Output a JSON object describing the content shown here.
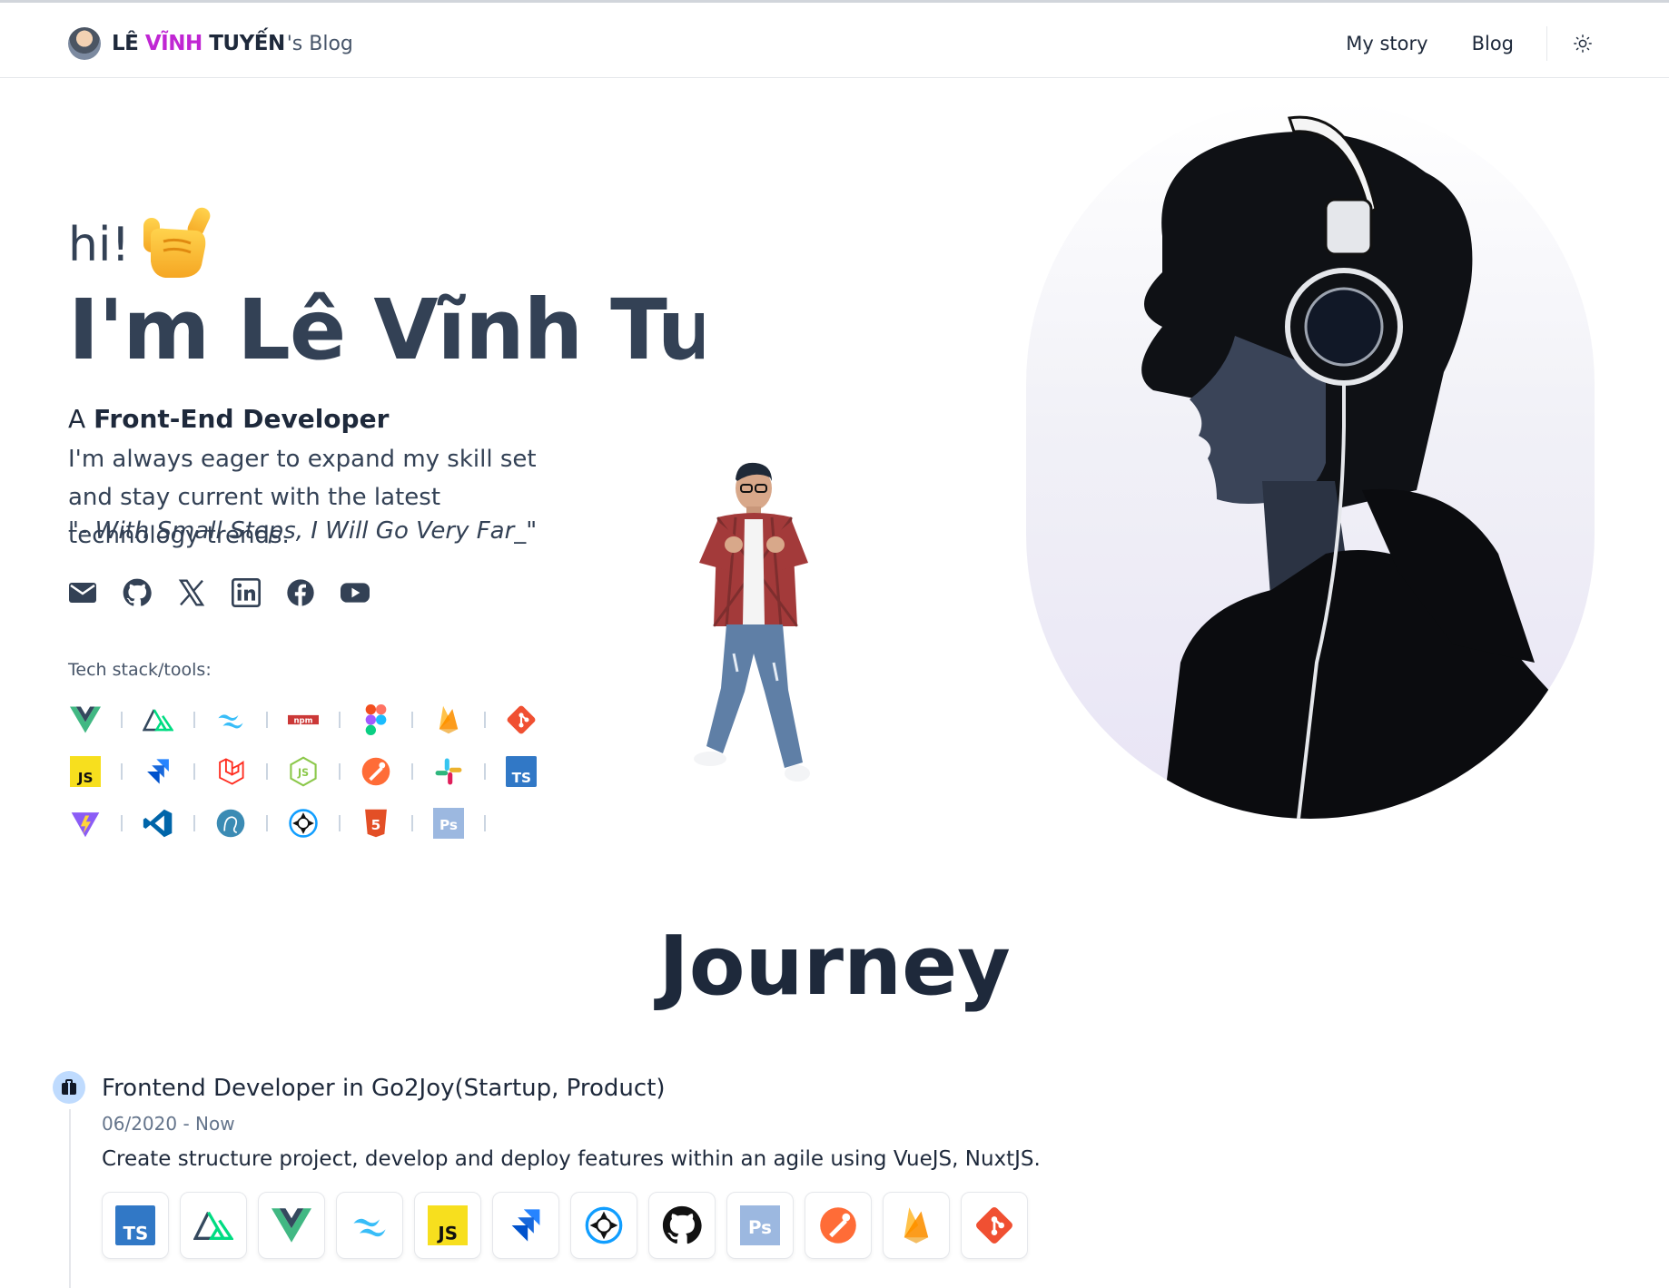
{
  "header": {
    "brand_name_part1": "LÊ ",
    "brand_name_highlight": "VĨNH",
    "brand_name_part2": " TUYẾN",
    "brand_suffix": "'s Blog",
    "nav": [
      {
        "label": "My story"
      },
      {
        "label": "Blog"
      }
    ],
    "theme_toggle_icon": "sun-icon"
  },
  "hero": {
    "greeting": "hi!",
    "greeting_emoji": "call-me-hand-icon",
    "name": "I'm Lê Vĩnh Tuy",
    "role_prefix": "A ",
    "role": "Front-End Developer",
    "bio": "I'm always eager to expand my skill set and stay current with the latest technology trends.",
    "quote": "\"- With Small Steps, I Will Go Very Far_\"",
    "socials": [
      "mail-icon",
      "github-icon",
      "x-icon",
      "linkedin-icon",
      "facebook-icon",
      "youtube-icon"
    ],
    "tech_label": "Tech stack/tools:",
    "tech_rows": [
      [
        "vue",
        "nuxt",
        "tailwind",
        "npm",
        "figma",
        "firebase",
        "git"
      ],
      [
        "javascript",
        "jira",
        "laravel",
        "nodejs",
        "postman",
        "slack",
        "typescript"
      ],
      [
        "vite",
        "vscode",
        "mysql",
        "capacitor",
        "html5",
        "photoshop"
      ]
    ],
    "tech_text": {
      "npm": "npm",
      "javascript": "JS",
      "typescript": "TS",
      "photoshop": "Ps",
      "nodejs": "JS",
      "html5": "5"
    }
  },
  "journey": {
    "title": "Journey",
    "jobs": [
      {
        "title": "Frontend Developer in Go2Joy(Startup, Product)",
        "date": "06/2020 - Now",
        "description": "Create structure project, develop and deploy features within an agile using VueJS, NuxtJS.",
        "tools": [
          "typescript",
          "nuxt",
          "vue",
          "tailwind",
          "javascript",
          "jira",
          "capacitor",
          "github",
          "photoshop",
          "postman",
          "firebase",
          "git"
        ]
      }
    ]
  },
  "colors": {
    "text_dark": "#1e293b",
    "text_slate": "#334155",
    "brand_highlight": "#c026d3",
    "vue_green": "#41b883",
    "vue_dark": "#34495e",
    "nuxt_green": "#00dc82",
    "tailwind": "#38bdf8",
    "npm_red": "#cb3837",
    "git_orange": "#f05032",
    "firebase": "#ffa000",
    "js_yellow": "#f7df1e",
    "ts_blue": "#3178c6",
    "jira_blue": "#2684ff",
    "laravel_red": "#ff2d20",
    "node_green": "#8cc84b",
    "postman_orange": "#ff6c37",
    "vscode_blue": "#0065a9",
    "html5_orange": "#e34f26",
    "ps_bg": "#9cb8e0"
  }
}
